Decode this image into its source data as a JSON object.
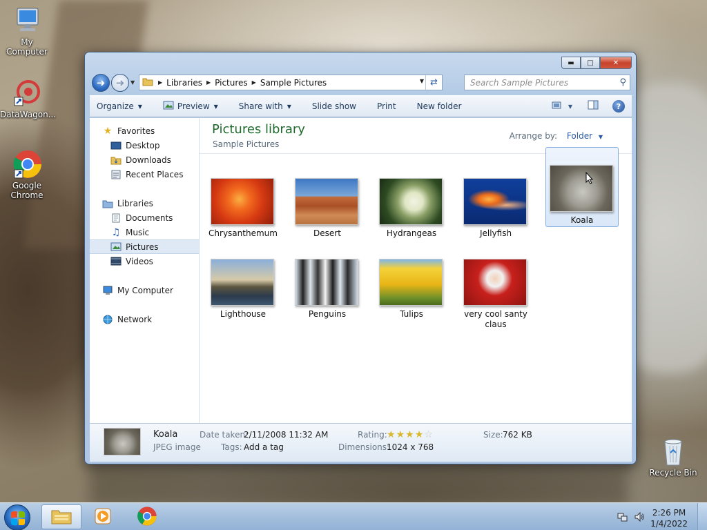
{
  "desktop": {
    "icons": [
      {
        "label": "My Computer",
        "icon": "computer-icon"
      },
      {
        "label": "DataWagon...",
        "icon": "datawagon-shortcut-icon"
      },
      {
        "label": "Google Chrome",
        "icon": "chrome-icon"
      },
      {
        "label": "Recycle Bin",
        "icon": "recycle-bin-icon"
      }
    ]
  },
  "window": {
    "breadcrumb": [
      "Libraries",
      "Pictures",
      "Sample Pictures"
    ],
    "search_placeholder": "Search Sample Pictures",
    "toolbar": {
      "organize": "Organize",
      "preview": "Preview",
      "share_with": "Share with",
      "slide_show": "Slide show",
      "print": "Print",
      "new_folder": "New folder"
    },
    "nav": {
      "favorites": "Favorites",
      "desktop": "Desktop",
      "downloads": "Downloads",
      "recent_places": "Recent Places",
      "libraries": "Libraries",
      "documents": "Documents",
      "music": "Music",
      "pictures": "Pictures",
      "videos": "Videos",
      "my_computer": "My Computer",
      "network": "Network"
    },
    "library": {
      "title": "Pictures library",
      "subtitle": "Sample Pictures",
      "arrange_label": "Arrange by:",
      "arrange_value": "Folder"
    },
    "files": [
      {
        "name": "Chrysanthemum"
      },
      {
        "name": "Desert"
      },
      {
        "name": "Hydrangeas"
      },
      {
        "name": "Jellyfish"
      },
      {
        "name": "Koala",
        "selected": true
      },
      {
        "name": "Lighthouse"
      },
      {
        "name": "Penguins"
      },
      {
        "name": "Tulips"
      },
      {
        "name": "very cool santy claus"
      }
    ],
    "details": {
      "name": "Koala",
      "type": "JPEG image",
      "date_taken_label": "Date taken:",
      "date_taken": "2/11/2008 11:32 AM",
      "tags_label": "Tags:",
      "tags": "Add a tag",
      "rating_label": "Rating:",
      "rating": 4,
      "rating_max": 5,
      "dimensions_label": "Dimensions:",
      "dimensions": "1024 x 768",
      "size_label": "Size:",
      "size": "762 KB"
    }
  },
  "taskbar": {
    "time": "2:26 PM",
    "date": "1/4/2022"
  }
}
